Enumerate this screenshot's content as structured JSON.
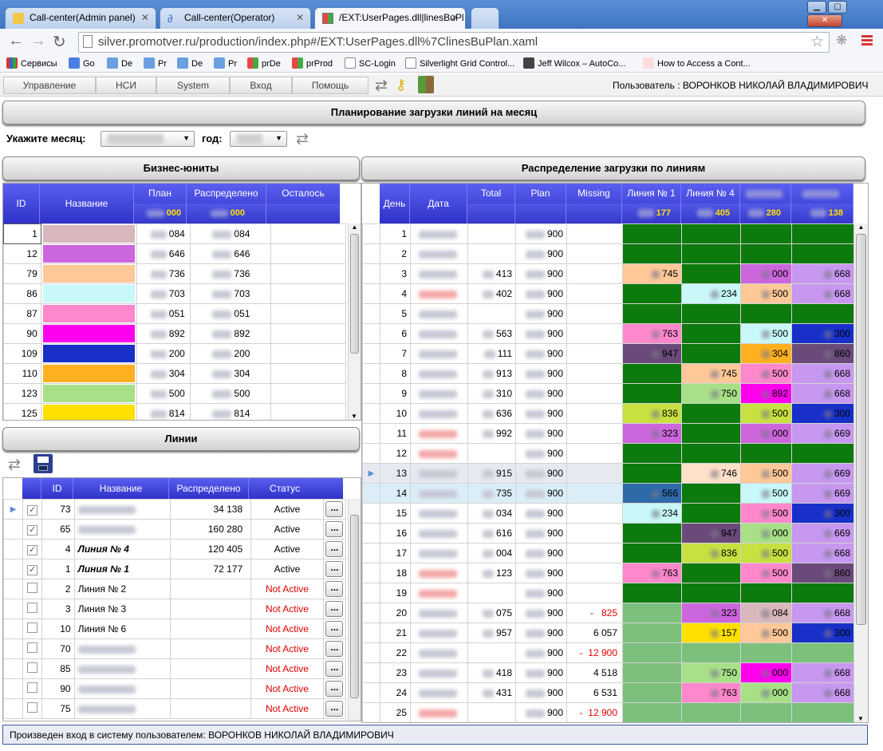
{
  "browser": {
    "tabs": [
      {
        "label": "Call-center(Admin panel)"
      },
      {
        "label": "Call-center(Operator)"
      },
      {
        "label": "/EXT:UserPages.dll|linesBuPl"
      }
    ],
    "url": "silver.promotver.ru/production/index.php#/EXT:UserPages.dll%7ClinesBuPlan.xaml",
    "bookmarks": [
      {
        "label": "Сервисы"
      },
      {
        "label": "Go"
      },
      {
        "label": "De"
      },
      {
        "label": "Pr"
      },
      {
        "label": "De"
      },
      {
        "label": "Pr"
      },
      {
        "label": "prDe"
      },
      {
        "label": "prProd"
      },
      {
        "label": "SC-Login"
      },
      {
        "label": "Silverlight Grid Control..."
      },
      {
        "label": "Jeff Wilcox – AutoCo..."
      },
      {
        "label": "How to Access a Cont..."
      }
    ]
  },
  "menu": {
    "items": [
      "Управление",
      "НСИ",
      "System",
      "Вход",
      "Помощь"
    ],
    "user_text": "Пользователь : ВОРОНКОВ НИКОЛАЙ ВЛАДИМИРОВИЧ"
  },
  "page_title": "Планирование загрузки линий на месяц",
  "filter": {
    "month_label": "Укажите месяц:",
    "year_label": "год:"
  },
  "bu": {
    "title": "Бизнес-юниты",
    "headers": [
      "ID",
      "Название",
      "План",
      "Распределено",
      "Осталось"
    ],
    "totals": [
      "000",
      "000"
    ],
    "rows": [
      {
        "id": "1",
        "color": "#d8b8bc",
        "plan": "084",
        "dist": "084"
      },
      {
        "id": "12",
        "color": "#cc66dd",
        "plan": "646",
        "dist": "646"
      },
      {
        "id": "79",
        "color": "#ffc898",
        "plan": "736",
        "dist": "736"
      },
      {
        "id": "86",
        "color": "#c8f8f8",
        "plan": "703",
        "dist": "703"
      },
      {
        "id": "87",
        "color": "#ff88cc",
        "plan": "051",
        "dist": "051"
      },
      {
        "id": "90",
        "color": "#ff00ee",
        "plan": "892",
        "dist": "892"
      },
      {
        "id": "109",
        "color": "#1830c8",
        "plan": "200",
        "dist": "200"
      },
      {
        "id": "110",
        "color": "#ffb020",
        "plan": "304",
        "dist": "304"
      },
      {
        "id": "123",
        "color": "#a8e088",
        "plan": "500",
        "dist": "500"
      },
      {
        "id": "125",
        "color": "#ffe000",
        "plan": "814",
        "dist": "814"
      }
    ]
  },
  "lines": {
    "title": "Линии",
    "headers": [
      "ID",
      "Название",
      "Распределено",
      "Статус"
    ],
    "rows": [
      {
        "id": "73",
        "name": "",
        "dist": "34 138",
        "status": "Active",
        "checked": true,
        "bold": false
      },
      {
        "id": "65",
        "name": "",
        "dist": "160 280",
        "status": "Active",
        "checked": true,
        "bold": false
      },
      {
        "id": "4",
        "name": "Линия № 4",
        "dist": "120 405",
        "status": "Active",
        "checked": true,
        "bold": true
      },
      {
        "id": "1",
        "name": "Линия № 1",
        "dist": "72 177",
        "status": "Active",
        "checked": true,
        "bold": true
      },
      {
        "id": "2",
        "name": "Линия № 2",
        "dist": "",
        "status": "Not Active",
        "checked": false,
        "bold": false
      },
      {
        "id": "3",
        "name": "Линия № 3",
        "dist": "",
        "status": "Not Active",
        "checked": false,
        "bold": false
      },
      {
        "id": "10",
        "name": "Линия № 6",
        "dist": "",
        "status": "Not Active",
        "checked": false,
        "bold": false
      },
      {
        "id": "70",
        "name": "",
        "dist": "",
        "status": "Not Active",
        "checked": false,
        "bold": false
      },
      {
        "id": "85",
        "name": "",
        "dist": "",
        "status": "Not Active",
        "checked": false,
        "bold": false
      },
      {
        "id": "90",
        "name": "",
        "dist": "",
        "status": "Not Active",
        "checked": false,
        "bold": false
      },
      {
        "id": "75",
        "name": "",
        "dist": "",
        "status": "Not Active",
        "checked": false,
        "bold": false
      }
    ],
    "dots": "..."
  },
  "dist": {
    "title": "Распределение загрузки по линиям",
    "headers": [
      "День",
      "Дата",
      "Total",
      "Plan",
      "Missing",
      "Линия № 1",
      "Линия № 4",
      "",
      ""
    ],
    "totals": [
      "177",
      "405",
      "280",
      "138"
    ],
    "rows": [
      {
        "day": "1",
        "red": false,
        "total": "",
        "plan": "900",
        "missing": "",
        "c": [
          [
            "#0c7a0c",
            ""
          ],
          [
            "#0c7a0c",
            ""
          ],
          [
            "#0c7a0c",
            ""
          ],
          [
            "#0c7a0c",
            ""
          ]
        ]
      },
      {
        "day": "2",
        "red": false,
        "total": "",
        "plan": "900",
        "missing": "",
        "c": [
          [
            "#0c7a0c",
            ""
          ],
          [
            "#0c7a0c",
            ""
          ],
          [
            "#0c7a0c",
            ""
          ],
          [
            "#0c7a0c",
            ""
          ]
        ]
      },
      {
        "day": "3",
        "red": false,
        "total": "413",
        "plan": "900",
        "missing": "",
        "c": [
          [
            "#ffc898",
            "745"
          ],
          [
            "#0c7a0c",
            ""
          ],
          [
            "#cc66dd",
            "000"
          ],
          [
            "#c898f0",
            "668"
          ]
        ]
      },
      {
        "day": "4",
        "red": true,
        "total": "402",
        "plan": "900",
        "missing": "",
        "c": [
          [
            "#0c7a0c",
            ""
          ],
          [
            "#c8f8f8",
            "234"
          ],
          [
            "#ffc898",
            "500"
          ],
          [
            "#c898f0",
            "668"
          ]
        ]
      },
      {
        "day": "5",
        "red": false,
        "total": "",
        "plan": "900",
        "missing": "",
        "c": [
          [
            "#0c7a0c",
            ""
          ],
          [
            "#0c7a0c",
            ""
          ],
          [
            "#0c7a0c",
            ""
          ],
          [
            "#0c7a0c",
            ""
          ]
        ]
      },
      {
        "day": "6",
        "red": false,
        "total": "563",
        "plan": "900",
        "missing": "",
        "c": [
          [
            "#ff88cc",
            "763"
          ],
          [
            "#0c7a0c",
            ""
          ],
          [
            "#c8f8f8",
            "500"
          ],
          [
            "#1830c8",
            "300"
          ]
        ]
      },
      {
        "day": "7",
        "red": false,
        "total": "111",
        "plan": "900",
        "missing": "",
        "c": [
          [
            "#6a4a7a",
            "947"
          ],
          [
            "#0c7a0c",
            ""
          ],
          [
            "#ffb020",
            "304"
          ],
          [
            "#6a4a7a",
            "860"
          ]
        ]
      },
      {
        "day": "8",
        "red": false,
        "total": "913",
        "plan": "900",
        "missing": "",
        "c": [
          [
            "#0c7a0c",
            ""
          ],
          [
            "#ffc898",
            "745"
          ],
          [
            "#ff88cc",
            "500"
          ],
          [
            "#c898f0",
            "668"
          ]
        ]
      },
      {
        "day": "9",
        "red": false,
        "total": "310",
        "plan": "900",
        "missing": "",
        "c": [
          [
            "#0c7a0c",
            ""
          ],
          [
            "#a8e088",
            "750"
          ],
          [
            "#ff00ee",
            "892"
          ],
          [
            "#c898f0",
            "668"
          ]
        ]
      },
      {
        "day": "10",
        "red": false,
        "total": "636",
        "plan": "900",
        "missing": "",
        "c": [
          [
            "#c8e040",
            "836"
          ],
          [
            "#0c7a0c",
            ""
          ],
          [
            "#c8e040",
            "500"
          ],
          [
            "#1830c8",
            "300"
          ]
        ]
      },
      {
        "day": "11",
        "red": true,
        "total": "992",
        "plan": "900",
        "missing": "",
        "c": [
          [
            "#cc66dd",
            "323"
          ],
          [
            "#0c7a0c",
            ""
          ],
          [
            "#cc66dd",
            "000"
          ],
          [
            "#c898f0",
            "669"
          ]
        ]
      },
      {
        "day": "12",
        "red": true,
        "total": "",
        "plan": "900",
        "missing": "",
        "c": [
          [
            "#0c7a0c",
            ""
          ],
          [
            "#0c7a0c",
            ""
          ],
          [
            "#0c7a0c",
            ""
          ],
          [
            "#0c7a0c",
            ""
          ]
        ]
      },
      {
        "day": "13",
        "red": false,
        "total": "915",
        "plan": "900",
        "missing": "",
        "c": [
          [
            "#0c7a0c",
            ""
          ],
          [
            "#ffe0c8",
            "746"
          ],
          [
            "#ffc898",
            "500"
          ],
          [
            "#c898f0",
            "669"
          ]
        ]
      },
      {
        "day": "14",
        "red": false,
        "total": "735",
        "plan": "900",
        "missing": "",
        "c": [
          [
            "#2e6aa8",
            "566"
          ],
          [
            "#0c7a0c",
            ""
          ],
          [
            "#c8f8f8",
            "500"
          ],
          [
            "#c898f0",
            "669"
          ]
        ]
      },
      {
        "day": "15",
        "red": false,
        "total": "034",
        "plan": "900",
        "missing": "",
        "c": [
          [
            "#c8f8f8",
            "234"
          ],
          [
            "#0c7a0c",
            ""
          ],
          [
            "#ff88cc",
            "500"
          ],
          [
            "#1830c8",
            "300"
          ]
        ]
      },
      {
        "day": "16",
        "red": false,
        "total": "616",
        "plan": "900",
        "missing": "",
        "c": [
          [
            "#0c7a0c",
            ""
          ],
          [
            "#6a4a7a",
            "947"
          ],
          [
            "#a8e088",
            "000"
          ],
          [
            "#c898f0",
            "669"
          ]
        ]
      },
      {
        "day": "17",
        "red": false,
        "total": "004",
        "plan": "900",
        "missing": "",
        "c": [
          [
            "#0c7a0c",
            ""
          ],
          [
            "#c8e040",
            "836"
          ],
          [
            "#c8e040",
            "500"
          ],
          [
            "#c898f0",
            "668"
          ]
        ]
      },
      {
        "day": "18",
        "red": true,
        "total": "123",
        "plan": "900",
        "missing": "",
        "c": [
          [
            "#ff88cc",
            "763"
          ],
          [
            "#0c7a0c",
            ""
          ],
          [
            "#ff88cc",
            "500"
          ],
          [
            "#6a4a7a",
            "860"
          ]
        ]
      },
      {
        "day": "19",
        "red": true,
        "total": "",
        "plan": "900",
        "missing": "",
        "c": [
          [
            "#0c7a0c",
            ""
          ],
          [
            "#0c7a0c",
            ""
          ],
          [
            "#0c7a0c",
            ""
          ],
          [
            "#0c7a0c",
            ""
          ]
        ]
      },
      {
        "day": "20",
        "red": false,
        "total": "075",
        "plan": "900",
        "missing": "-   825",
        "c": [
          [
            "#7cc07c",
            ""
          ],
          [
            "#cc66dd",
            "323"
          ],
          [
            "#d8b8bc",
            "084"
          ],
          [
            "#c898f0",
            "668"
          ]
        ]
      },
      {
        "day": "21",
        "red": false,
        "total": "957",
        "plan": "900",
        "missing": "6 057",
        "c": [
          [
            "#7cc07c",
            ""
          ],
          [
            "#ffe000",
            "157"
          ],
          [
            "#ffc898",
            "500"
          ],
          [
            "#1830c8",
            "300"
          ]
        ]
      },
      {
        "day": "22",
        "red": false,
        "total": "",
        "plan": "900",
        "missing": "-  12 900",
        "c": [
          [
            "#7cc07c",
            ""
          ],
          [
            "#7cc07c",
            ""
          ],
          [
            "#7cc07c",
            ""
          ],
          [
            "#7cc07c",
            ""
          ]
        ]
      },
      {
        "day": "23",
        "red": false,
        "total": "418",
        "plan": "900",
        "missing": "4 518",
        "c": [
          [
            "#7cc07c",
            ""
          ],
          [
            "#a8e088",
            "750"
          ],
          [
            "#ff00ee",
            "000"
          ],
          [
            "#c898f0",
            "668"
          ]
        ]
      },
      {
        "day": "24",
        "red": false,
        "total": "431",
        "plan": "900",
        "missing": "6 531",
        "c": [
          [
            "#7cc07c",
            ""
          ],
          [
            "#ff88cc",
            "763"
          ],
          [
            "#a8e088",
            "000"
          ],
          [
            "#c898f0",
            "668"
          ]
        ]
      },
      {
        "day": "25",
        "red": true,
        "total": "",
        "plan": "900",
        "missing": "-  12 900",
        "c": [
          [
            "#7cc07c",
            ""
          ],
          [
            "#7cc07c",
            ""
          ],
          [
            "#7cc07c",
            ""
          ],
          [
            "#7cc07c",
            ""
          ]
        ]
      }
    ]
  },
  "status_text": "Произвeден вход в систему пользователем: ВОРОНКОВ НИКОЛАЙ ВЛАДИМИРОВИЧ"
}
